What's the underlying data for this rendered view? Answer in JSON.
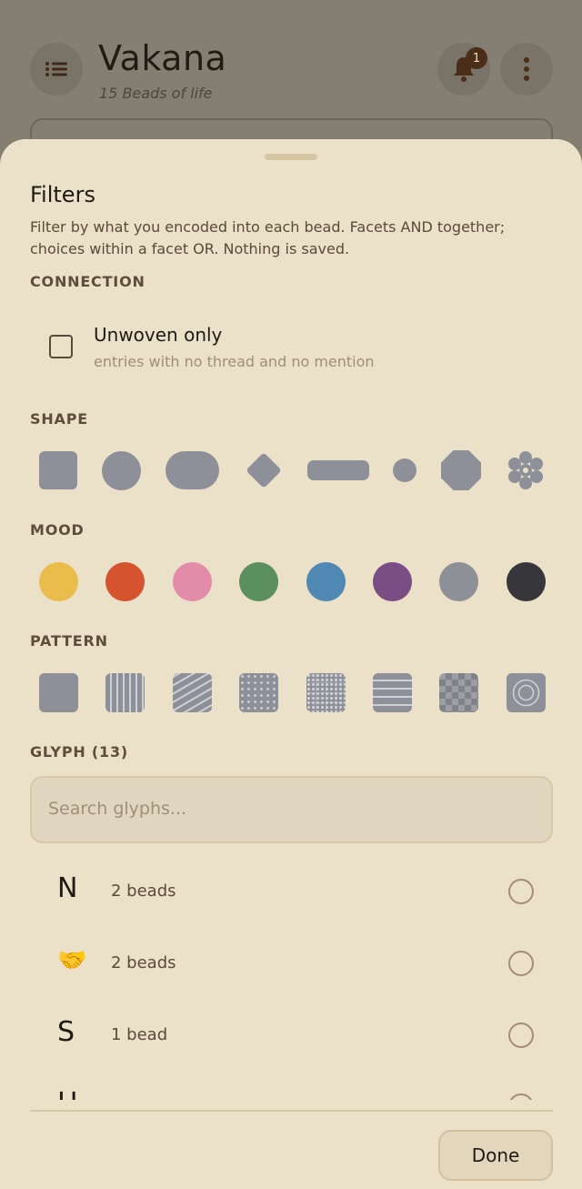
{
  "app": {
    "title": "Vakana",
    "subtitle": "15 Beads of life",
    "notification_count": "1"
  },
  "sheet": {
    "title": "Filters",
    "description": "Filter by what you encoded into each bead. Facets AND together; choices within a facet OR. Nothing is saved.",
    "connection": {
      "heading": "CONNECTION",
      "checkbox_label": "Unwoven only",
      "checkbox_sub": "entries with no thread and no mention",
      "checked": false
    },
    "shape": {
      "heading": "SHAPE",
      "items": [
        "square",
        "circle",
        "pill",
        "diamond",
        "bar",
        "dot",
        "octagon",
        "flower"
      ]
    },
    "mood": {
      "heading": "MOOD",
      "colors": [
        "#e9bc4c",
        "#d5532f",
        "#e38ca9",
        "#5b8f5e",
        "#4f88b3",
        "#7b4d85",
        "#8e9097",
        "#37363b"
      ]
    },
    "pattern": {
      "heading": "PATTERN",
      "items": [
        "solid",
        "vertical-stripes",
        "diagonal-stripes",
        "dots",
        "grid-dots",
        "horizontal-stripes",
        "checker",
        "rings"
      ]
    },
    "glyph": {
      "heading": "GLYPH (13)",
      "search_placeholder": "Search glyphs...",
      "items": [
        {
          "glyph": "N",
          "count": "2 beads"
        },
        {
          "glyph": "🤝",
          "count": "2 beads"
        },
        {
          "glyph": "S",
          "count": "1 bead"
        },
        {
          "glyph": "H",
          "count": ""
        }
      ]
    },
    "done_label": "Done"
  }
}
